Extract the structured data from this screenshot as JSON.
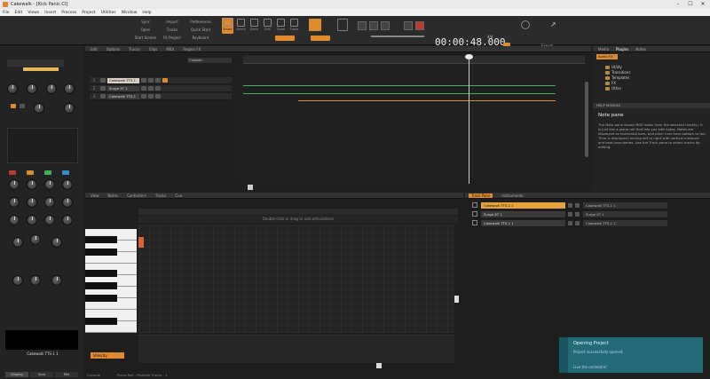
{
  "window": {
    "title": "Cakewalk - [Kick Panic.CI]"
  },
  "menu": [
    "File",
    "Edit",
    "Views",
    "Insert",
    "Process",
    "Project",
    "Utilities",
    "Window",
    "Help"
  ],
  "toolbar": {
    "modules_left": [
      "Sync",
      "Import",
      "Preferences",
      "Open",
      "Tracks",
      "Quick Start",
      "Start Screen",
      "Fit Project",
      "Keyboard"
    ],
    "tools": [
      {
        "label": "Smart",
        "active": true
      },
      {
        "label": "Select",
        "active": false
      },
      {
        "label": "Move",
        "active": false
      },
      {
        "label": "Edit",
        "active": false
      },
      {
        "label": "Draw",
        "active": false
      },
      {
        "label": "Erase",
        "active": false
      }
    ],
    "time": "00:00:48.000",
    "tempo": "120.00",
    "meter": "4/4",
    "right_labels": [
      "Export",
      "Project"
    ]
  },
  "inspector": {
    "track_name": "Cakewalk TTS-1 1",
    "tabs": [
      "Display",
      "Solo",
      "Mix"
    ]
  },
  "track_view": {
    "tabs": [
      "Edit",
      "Options",
      "Tracks",
      "Clips",
      "MIDI",
      "Region FX"
    ],
    "filter": "Custom",
    "tracks": [
      {
        "num": "1",
        "name": "Cakewalk TTS-1",
        "selected": true
      },
      {
        "num": "2",
        "name": "Surge XT 1",
        "selected": false
      },
      {
        "num": "3",
        "name": "Cakewalk TTS-1",
        "selected": false
      }
    ]
  },
  "piano_roll": {
    "tabs": [
      "View",
      "Notes",
      "Controllers",
      "Tracks",
      "Cue"
    ],
    "hint": "Double-click or drag to add articulations",
    "velocity_label": "Velocity",
    "status": [
      "Piano Roll - Multiple Tracks - 1",
      "Console"
    ]
  },
  "track_pane": {
    "tabs": [
      "Track Pane",
      "Instruments"
    ],
    "rows": [
      {
        "name": "Cakewalk TTS-1 1",
        "right": "Cakewalk TTS-1 1",
        "selected": true
      },
      {
        "name": "Surge XT 1",
        "right": "Surge XT 1",
        "selected": false
      },
      {
        "name": "Cakewalk TTS-1 1",
        "right": "Cakewalk TTS-1 1",
        "selected": false
      }
    ]
  },
  "browser": {
    "tabs": [
      "Media",
      "Plugins",
      "Notes"
    ],
    "location": "Audio FX",
    "items": [
      "Utility",
      "Transitions",
      "Templates",
      "FX",
      "Other"
    ],
    "help_title": "HELP MODULE",
    "help_heading": "Note pane",
    "help_text": "The Note pane shows MIDI notes from the selected track(s). It is just like a piano roll that lets you edit notes. Notes are displayed as horizontal bars, and pitch runs from bottom to top. Time is displayed running left to right with vertical measure and beat boundaries. Use the Track pane to select tracks for editing."
  },
  "toast": {
    "title": "Opening Project",
    "message": "Project successfully opened.",
    "footer": "Live the orchestra!"
  },
  "colors": {
    "accent": "#e08a2e",
    "toast": "#246b7a",
    "clip_green": "#3cb35a",
    "clip_orange": "#e08a2e"
  }
}
